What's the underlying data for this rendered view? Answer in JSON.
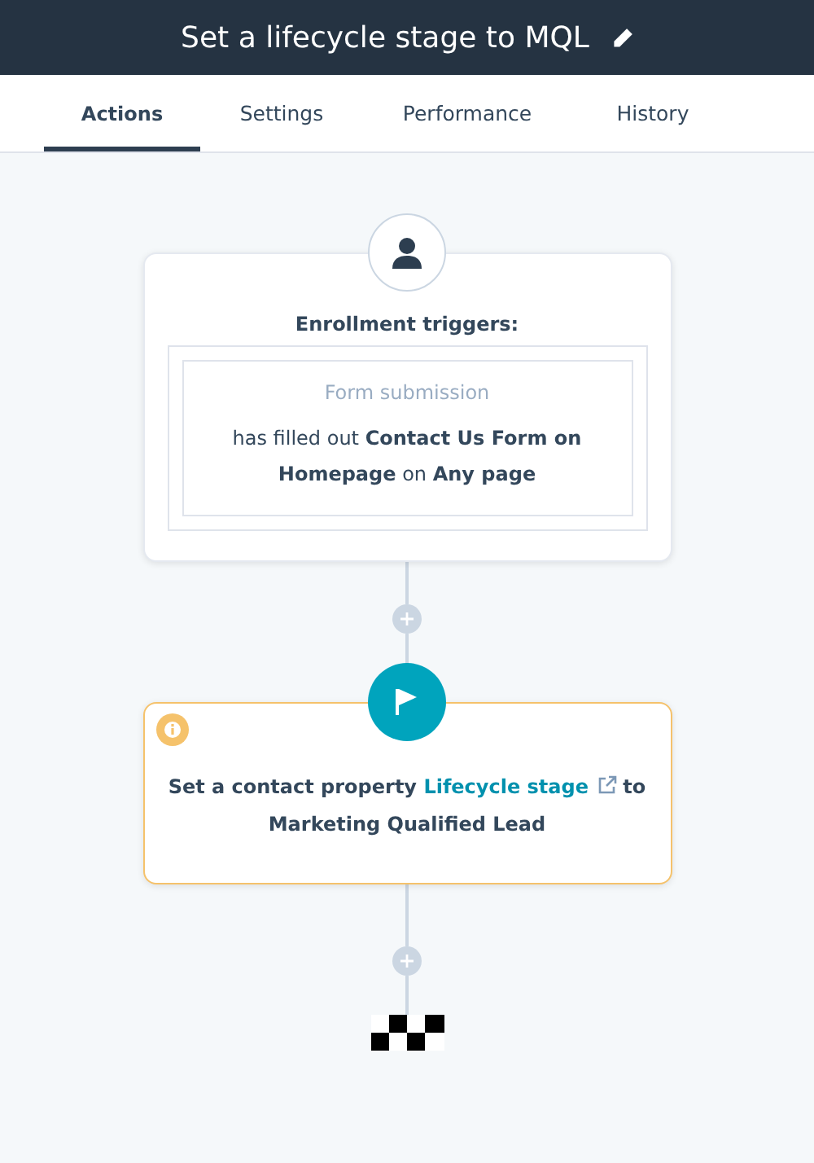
{
  "header": {
    "title": "Set a lifecycle stage to MQL"
  },
  "tabs": [
    {
      "label": "Actions",
      "selected": true
    },
    {
      "label": "Settings",
      "selected": false
    },
    {
      "label": "Performance",
      "selected": false
    },
    {
      "label": "History",
      "selected": false
    }
  ],
  "trigger": {
    "heading": "Enrollment triggers:",
    "filter_type": "Form submission",
    "filter": "has filled out **Contact Us Form on Homepage** on **Any page**"
  },
  "action": {
    "prefix": "Set a contact property",
    "link": "Lifecycle stage",
    "suffix": "to",
    "value": "Marketing Qualified Lead"
  }
}
